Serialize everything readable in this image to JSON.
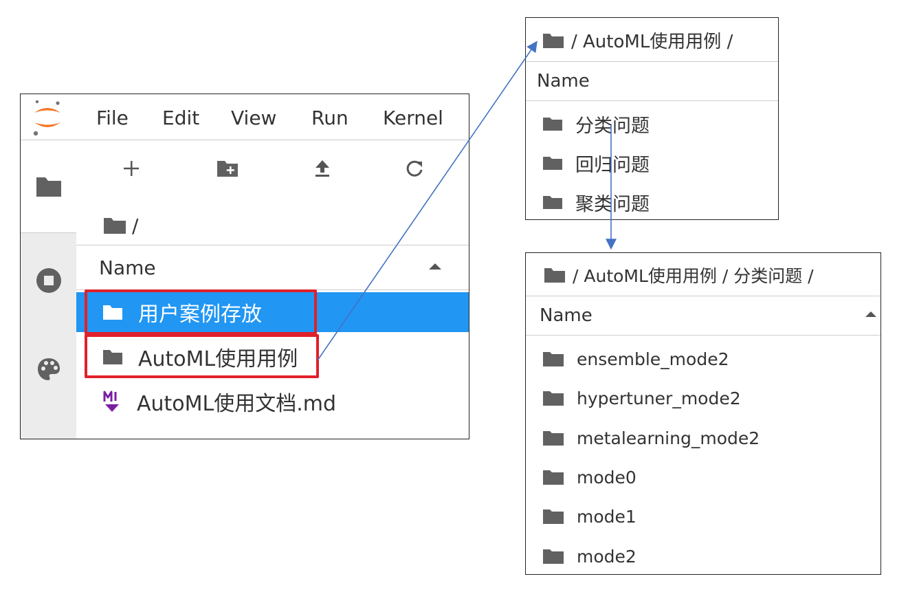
{
  "main_panel": {
    "menu": [
      "File",
      "Edit",
      "View",
      "Run",
      "Kernel"
    ],
    "breadcrumb": "/",
    "list_header": "Name",
    "files": [
      {
        "name": "用户案例存放",
        "type": "folder",
        "selected": true
      },
      {
        "name": "AutoML使用用例",
        "type": "folder",
        "selected": false
      },
      {
        "name": "AutoML使用文档.md",
        "type": "markdown",
        "selected": false
      }
    ],
    "toolbar_icons": [
      "plus-icon",
      "new-folder-icon",
      "upload-icon",
      "refresh-icon"
    ],
    "sidebar_icons": [
      "folder-icon",
      "stop-circle-icon",
      "palette-icon"
    ]
  },
  "panel_level2": {
    "breadcrumb": "/ AutoML使用用例 /",
    "list_header": "Name",
    "folders": [
      "分类问题",
      "回归问题",
      "聚类问题"
    ]
  },
  "panel_level3": {
    "breadcrumb": "/ AutoML使用用例 / 分类问题 /",
    "list_header": "Name",
    "folders": [
      "ensemble_mode2",
      "hypertuner_mode2",
      "metalearning_mode2",
      "mode0",
      "mode1",
      "mode2"
    ]
  },
  "colors": {
    "selection": "#2196f3",
    "highlight_box": "#e0202a",
    "arrow": "#4472c4",
    "logo": "#f37726"
  }
}
